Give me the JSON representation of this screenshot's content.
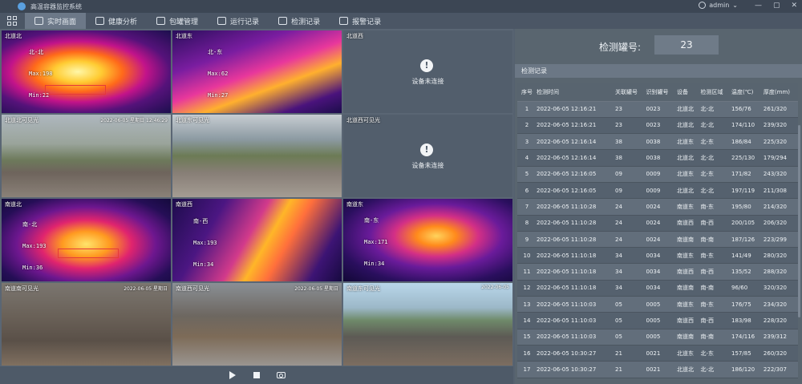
{
  "app": {
    "title": "高温容器监控系统",
    "user": "admin",
    "window_controls": [
      "—",
      "▢",
      "✕"
    ]
  },
  "menu": {
    "items": [
      {
        "label": "实时画面",
        "icon": "camera-icon",
        "active": true
      },
      {
        "label": "健康分析",
        "icon": "chart-icon",
        "active": false
      },
      {
        "label": "包罐管理",
        "icon": "tank-icon",
        "active": false
      },
      {
        "label": "运行记录",
        "icon": "monitor-icon",
        "active": false
      },
      {
        "label": "检测记录",
        "icon": "list-icon",
        "active": false
      },
      {
        "label": "报警记录",
        "icon": "document-icon",
        "active": false
      }
    ]
  },
  "cameras": [
    {
      "name": "北道北",
      "type": "thermal",
      "overlay": [
        "北-北",
        "Max:198",
        "Min:22"
      ]
    },
    {
      "name": "北道东",
      "type": "thermal",
      "overlay": [
        "北-东",
        "Max:62",
        "Min:27"
      ]
    },
    {
      "name": "北道西",
      "type": "offline",
      "status": "设备未连接"
    },
    {
      "name": "北道北可见光",
      "type": "visible",
      "timestamp": "2022-06-05 星期日 12:46:29"
    },
    {
      "name": "北道东可见光",
      "type": "visible",
      "timestamp": ""
    },
    {
      "name": "北道西可见光",
      "type": "offline",
      "status": "设备未连接"
    },
    {
      "name": "南道北",
      "type": "thermal",
      "overlay": [
        "南-北",
        "Max:193",
        "Min:36"
      ]
    },
    {
      "name": "南道西",
      "type": "thermal",
      "overlay": [
        "南-西",
        "Max:193",
        "Min:34"
      ]
    },
    {
      "name": "南道东",
      "type": "thermal",
      "overlay": [
        "南-东",
        "Max:171",
        "Min:34"
      ]
    },
    {
      "name": "南道南可见光",
      "type": "visible",
      "timestamp": "2022-06-05 星期日"
    },
    {
      "name": "南道西可见光",
      "type": "visible",
      "timestamp": "2022-06-05 星期日"
    },
    {
      "name": "南道东可见光",
      "type": "visible",
      "timestamp": "2022-06-05"
    }
  ],
  "tank": {
    "label": "检测罐号:",
    "value": "23"
  },
  "records": {
    "title": "检测记录",
    "columns": [
      "序号",
      "检测时间",
      "关联罐号",
      "识别罐号",
      "设备",
      "检测区域",
      "温度(℃)",
      "厚度(mm)"
    ],
    "rows": [
      [
        "1",
        "2022-06-05 12:16:21",
        "23",
        "0023",
        "北道北",
        "北-北",
        "156/76",
        "261/320"
      ],
      [
        "2",
        "2022-06-05 12:16:21",
        "23",
        "0023",
        "北道北",
        "北-北",
        "174/110",
        "239/320"
      ],
      [
        "3",
        "2022-06-05 12:16:14",
        "38",
        "0038",
        "北道东",
        "北-东",
        "186/84",
        "225/320"
      ],
      [
        "4",
        "2022-06-05 12:16:14",
        "38",
        "0038",
        "北道北",
        "北-北",
        "225/130",
        "179/294"
      ],
      [
        "5",
        "2022-06-05 12:16:05",
        "09",
        "0009",
        "北道东",
        "北-东",
        "171/82",
        "243/320"
      ],
      [
        "6",
        "2022-06-05 12:16:05",
        "09",
        "0009",
        "北道北",
        "北-北",
        "197/119",
        "211/308"
      ],
      [
        "7",
        "2022-06-05 11:10:28",
        "24",
        "0024",
        "南道东",
        "南-东",
        "195/80",
        "214/320"
      ],
      [
        "8",
        "2022-06-05 11:10:28",
        "24",
        "0024",
        "南道西",
        "南-西",
        "200/105",
        "206/320"
      ],
      [
        "9",
        "2022-06-05 11:10:28",
        "24",
        "0024",
        "南道南",
        "南-南",
        "187/126",
        "223/299"
      ],
      [
        "10",
        "2022-06-05 11:10:18",
        "34",
        "0034",
        "南道东",
        "南-东",
        "141/49",
        "280/320"
      ],
      [
        "11",
        "2022-06-05 11:10:18",
        "34",
        "0034",
        "南道西",
        "南-西",
        "135/52",
        "288/320"
      ],
      [
        "12",
        "2022-06-05 11:10:18",
        "34",
        "0034",
        "南道南",
        "南-南",
        "96/60",
        "320/320"
      ],
      [
        "13",
        "2022-06-05 11:10:03",
        "05",
        "0005",
        "南道东",
        "南-东",
        "176/75",
        "234/320"
      ],
      [
        "14",
        "2022-06-05 11:10:03",
        "05",
        "0005",
        "南道西",
        "南-西",
        "183/98",
        "228/320"
      ],
      [
        "15",
        "2022-06-05 11:10:03",
        "05",
        "0005",
        "南道南",
        "南-南",
        "174/116",
        "239/312"
      ],
      [
        "16",
        "2022-06-05 10:30:27",
        "21",
        "0021",
        "北道东",
        "北-东",
        "157/85",
        "260/320"
      ],
      [
        "17",
        "2022-06-05 10:30:27",
        "21",
        "0021",
        "北道北",
        "北-北",
        "186/120",
        "222/307"
      ]
    ]
  },
  "controls": {
    "play": "play-icon",
    "stop": "stop-icon",
    "snapshot": "camera-icon"
  }
}
